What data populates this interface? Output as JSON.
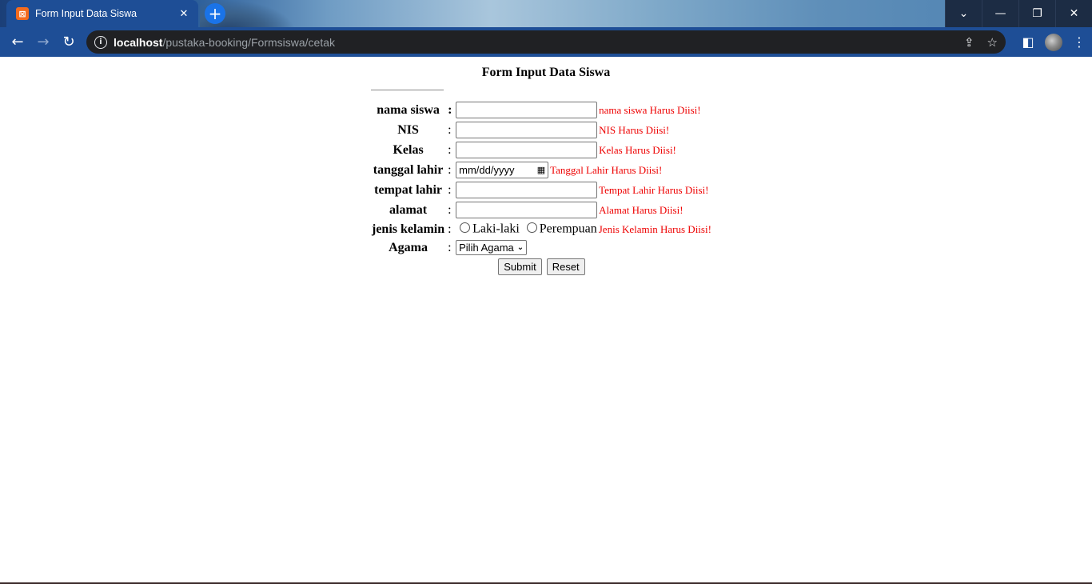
{
  "browser": {
    "tab_title": "Form Input Data Siswa",
    "favicon_text": "⊠",
    "url_host": "localhost",
    "url_path": "/pustaka-booking/Formsiswa/cetak",
    "icons": [
      "back-icon",
      "forward-icon",
      "reload-icon",
      "site-info-icon",
      "share-icon",
      "star-icon",
      "side-panel-icon",
      "avatar",
      "more-menu-icon",
      "tab-list-icon",
      "minimize-icon",
      "restore-icon",
      "close-window-icon",
      "new-tab-icon",
      "tab-close-icon"
    ]
  },
  "form": {
    "heading": "Form Input Data Siswa",
    "fields": [
      {
        "label": "nama siswa",
        "colon": ":",
        "error": "nama siswa Harus Diisi!"
      },
      {
        "label": "NIS",
        "colon": ":",
        "error": "NIS Harus Diisi!"
      },
      {
        "label": "Kelas",
        "colon": ":",
        "error": "Kelas Harus Diisi!"
      },
      {
        "label": "tanggal lahir",
        "colon": ":",
        "placeholder": "mm/dd/yyyy",
        "error": "Tanggal Lahir Harus Diisi!"
      },
      {
        "label": "tempat lahir",
        "colon": ":",
        "error": "Tempat Lahir Harus Diisi!"
      },
      {
        "label": "alamat",
        "colon": ":",
        "error": "Alamat Harus Diisi!"
      },
      {
        "label": "jenis kelamin",
        "colon": ":",
        "options": [
          "Laki-laki",
          "Perempuan"
        ],
        "error": "Jenis Kelamin Harus Diisi!"
      },
      {
        "label": "Agama",
        "colon": ":",
        "selected": "Pilih Agama"
      }
    ],
    "submit_label": "Submit",
    "reset_label": "Reset"
  }
}
